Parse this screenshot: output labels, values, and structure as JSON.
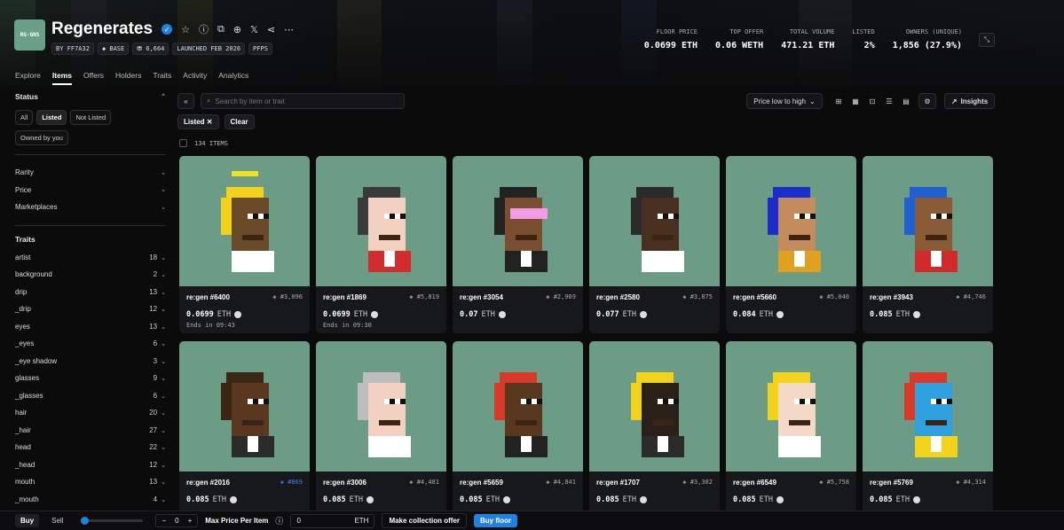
{
  "collection": {
    "logo_text": "RG·GNS",
    "name": "Regenerates",
    "badges": [
      "BY FF7A32",
      "◆ BASE",
      "⛃ 6,664",
      "LAUNCHED FEB 2026",
      "PFPS"
    ]
  },
  "stats": [
    {
      "label": "FLOOR PRICE",
      "value": "0.0699 ETH"
    },
    {
      "label": "TOP OFFER",
      "value": "0.06 WETH"
    },
    {
      "label": "TOTAL VOLUME",
      "value": "471.21 ETH"
    },
    {
      "label": "LISTED",
      "value": "2%"
    },
    {
      "label": "OWNERS (UNIQUE)",
      "value": "1,856 (27.9%)"
    }
  ],
  "tabs": [
    "Explore",
    "Items",
    "Offers",
    "Holders",
    "Traits",
    "Activity",
    "Analytics"
  ],
  "sidebar": {
    "status_label": "Status",
    "status_pills": [
      "All",
      "Listed",
      "Not Listed",
      "Owned by you"
    ],
    "filters": [
      "Rarity",
      "Price",
      "Marketplaces"
    ],
    "traits_label": "Traits",
    "traits": [
      {
        "name": "artist",
        "count": "18"
      },
      {
        "name": "background",
        "count": "2"
      },
      {
        "name": "drip",
        "count": "13"
      },
      {
        "name": "_drip",
        "count": "12"
      },
      {
        "name": "eyes",
        "count": "13"
      },
      {
        "name": "_eyes",
        "count": "6"
      },
      {
        "name": "_eye shadow",
        "count": "3"
      },
      {
        "name": "glasses",
        "count": "9"
      },
      {
        "name": "_glasses",
        "count": "6"
      },
      {
        "name": "hair",
        "count": "20"
      },
      {
        "name": "_hair",
        "count": "27"
      },
      {
        "name": "head",
        "count": "22"
      },
      {
        "name": "_head",
        "count": "12"
      },
      {
        "name": "mouth",
        "count": "13"
      },
      {
        "name": "_mouth",
        "count": "4"
      }
    ]
  },
  "toolbar": {
    "search_placeholder": "Search by item or trait",
    "sort": "Price low to high",
    "insights": "Insights",
    "collapse": "«"
  },
  "chips": {
    "listed": "Listed",
    "close": "✕",
    "clear": "Clear"
  },
  "item_count": "134 ITEMS",
  "items": [
    {
      "name": "re:gen #6400",
      "rank": "#3,096",
      "price": "0.0699",
      "unit": "ETH",
      "ends": "Ends in 09:43",
      "skin": "#6b4a2a",
      "hair": "#f2d21b",
      "shirt": "#ffffff",
      "halo": true
    },
    {
      "name": "re:gen #1869",
      "rank": "#5,819",
      "price": "0.0699",
      "unit": "ETH",
      "ends": "Ends in 09:30",
      "skin": "#f2d1c0",
      "hair": "#3a3a3a",
      "shirt": "#d32c2c"
    },
    {
      "name": "re:gen #3054",
      "rank": "#2,969",
      "price": "0.07",
      "unit": "ETH",
      "ends": "",
      "skin": "#7a4e2e",
      "hair": "#222222",
      "shirt": "#222222",
      "visor": "#f29be8"
    },
    {
      "name": "re:gen #2580",
      "rank": "#3,875",
      "price": "0.077",
      "unit": "ETH",
      "ends": "",
      "skin": "#4a3020",
      "hair": "#2b2b2b",
      "shirt": "#ffffff"
    },
    {
      "name": "re:gen #5660",
      "rank": "#5,040",
      "price": "0.084",
      "unit": "ETH",
      "ends": "",
      "skin": "#c48c5c",
      "hair": "#1c2ccf",
      "shirt": "#e0a020"
    },
    {
      "name": "re:gen #3943",
      "rank": "#4,746",
      "price": "0.085",
      "unit": "ETH",
      "ends": "",
      "skin": "#8a5a36",
      "hair": "#1f5fd1",
      "shirt": "#d22a2a"
    },
    {
      "name": "re:gen #2016",
      "rank": "#869",
      "price": "0.085",
      "unit": "ETH",
      "ends": "",
      "skin": "#5a3820",
      "hair": "#3b2616",
      "shirt": "#2a2a2a",
      "blue": true
    },
    {
      "name": "re:gen #3006",
      "rank": "#4,481",
      "price": "0.085",
      "unit": "ETH",
      "ends": "",
      "skin": "#f2d1c0",
      "hair": "#bdbdbd",
      "shirt": "#ffffff"
    },
    {
      "name": "re:gen #5659",
      "rank": "#4,841",
      "price": "0.085",
      "unit": "ETH",
      "ends": "",
      "skin": "#5a3820",
      "hair": "#d83a2a",
      "shirt": "#222222"
    },
    {
      "name": "re:gen #1707",
      "rank": "#3,302",
      "price": "0.085",
      "unit": "ETH",
      "ends": "",
      "skin": "#2b2018",
      "hair": "#f2d21b",
      "shirt": "#2b2b2b"
    },
    {
      "name": "re:gen #6549",
      "rank": "#5,758",
      "price": "0.085",
      "unit": "ETH",
      "ends": "",
      "skin": "#f4d9c8",
      "hair": "#f2d21b",
      "shirt": "#ffffff"
    },
    {
      "name": "re:gen #5769",
      "rank": "#4,314",
      "price": "0.085",
      "unit": "ETH",
      "ends": "",
      "skin": "#2ea0e0",
      "hair": "#d83a2a",
      "shirt": "#f2d21b"
    }
  ],
  "bottom": {
    "buy": "Buy",
    "sell": "Sell",
    "qty": "0",
    "minus": "−",
    "plus": "+",
    "max_label": "Max Price Per Item",
    "max_value": "0",
    "unit": "ETH",
    "offer": "Make collection offer",
    "buy_floor": "Buy floor"
  },
  "colors": {
    "accent": "#2081e2",
    "card_bg": "#6c9c86"
  }
}
